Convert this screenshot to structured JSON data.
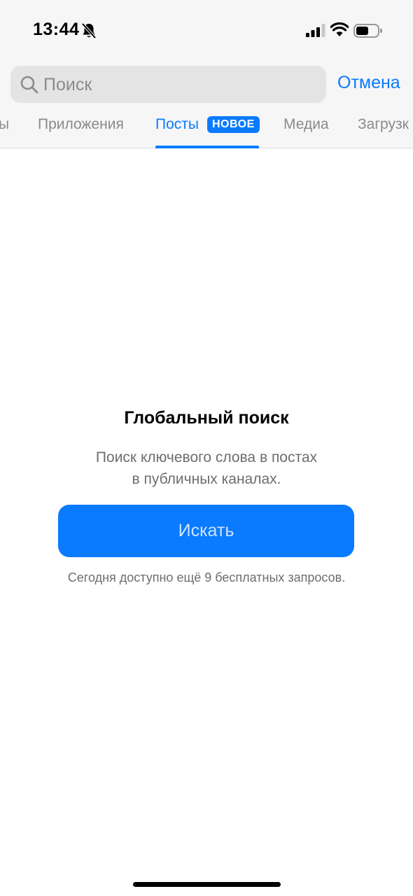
{
  "status_bar": {
    "time": "13:44",
    "icons": [
      "bell-slash-icon",
      "signal-icon",
      "wifi-icon",
      "battery-icon"
    ]
  },
  "search": {
    "placeholder": "Поиск",
    "value": "",
    "cancel_label": "Отмена"
  },
  "tabs": {
    "items": [
      {
        "label": "ы"
      },
      {
        "label": "Приложения"
      },
      {
        "label": "Посты",
        "badge": "НОВОЕ",
        "active": true
      },
      {
        "label": "Медиа"
      },
      {
        "label": "Загрузк"
      }
    ]
  },
  "main": {
    "title": "Глобальный поиск",
    "description_line1": "Поиск ключевого слова в постах",
    "description_line2": "в публичных каналах.",
    "button_label": "Искать",
    "quota_text": "Сегодня доступно ещё 9 бесплатных запросов."
  },
  "colors": {
    "accent": "#0a7aff",
    "background": "#ffffff",
    "header_background": "#f6f6f6",
    "secondary_text": "#6d6d72"
  }
}
